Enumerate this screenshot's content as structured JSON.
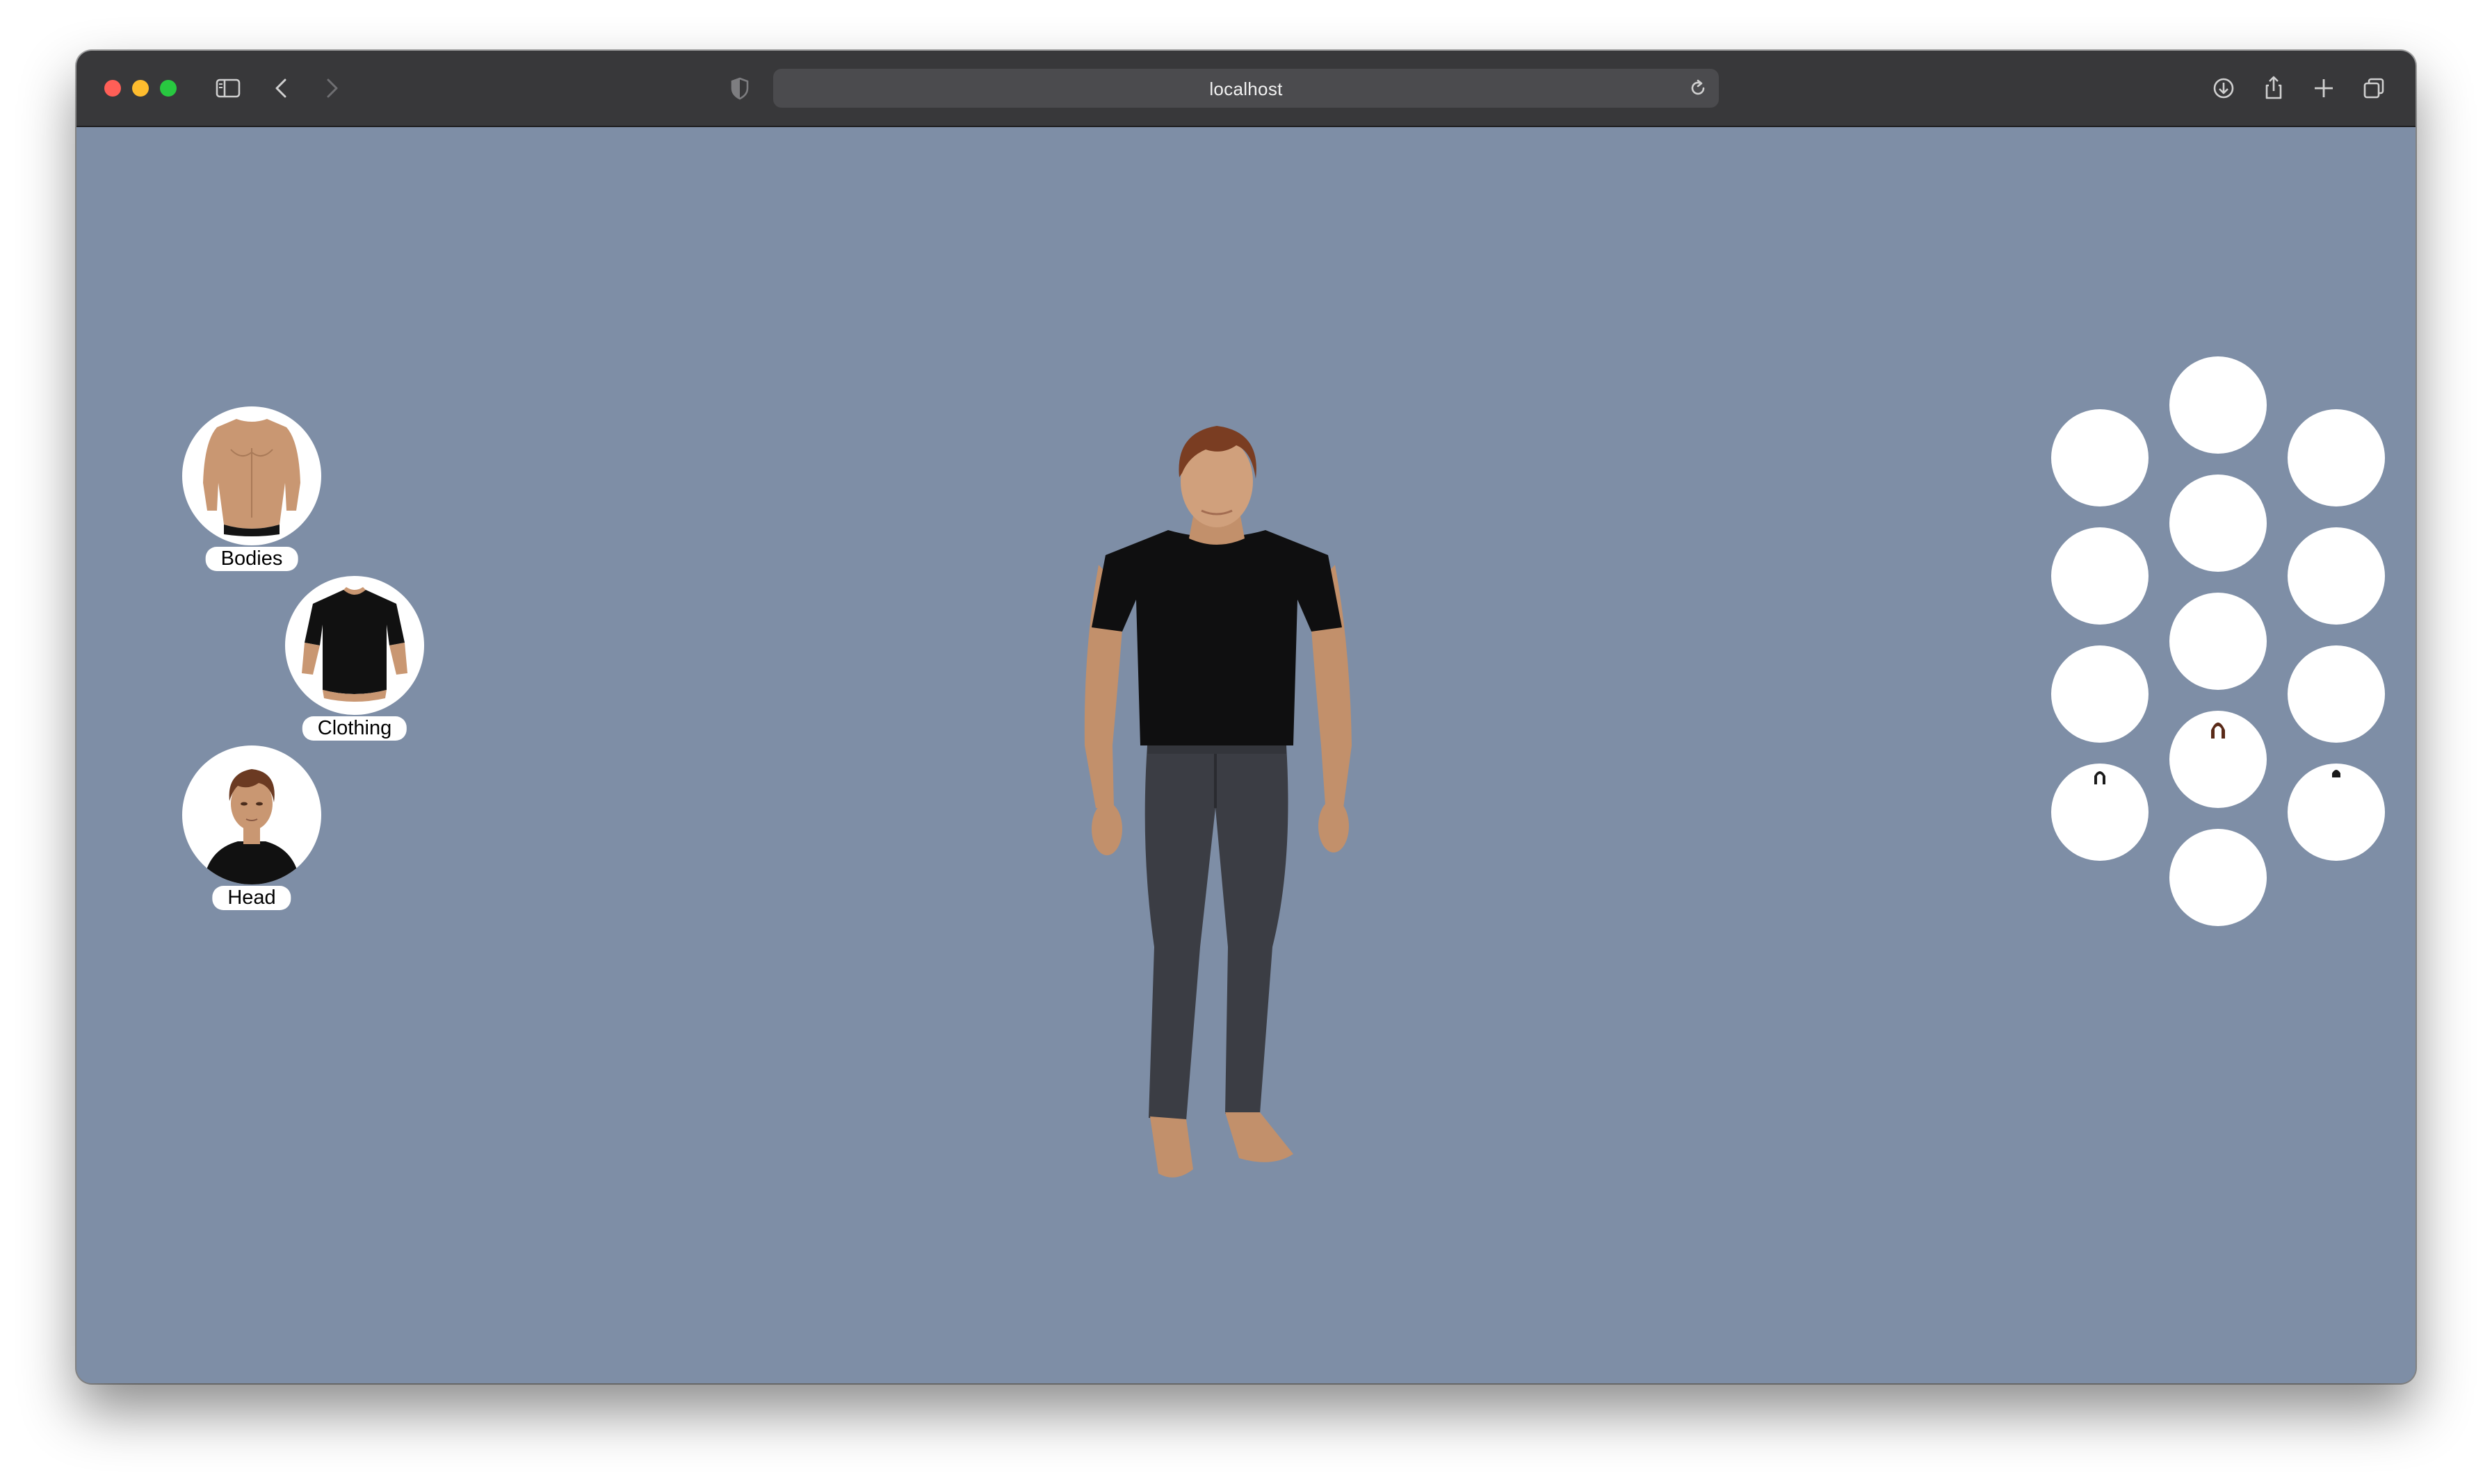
{
  "browser": {
    "url": "localhost",
    "traffic_lights": {
      "close": "#ff5f57",
      "minimize": "#febc2e",
      "zoom": "#28c840"
    },
    "toolbar_color": "#38383a"
  },
  "page": {
    "background": "#7e8ea6",
    "categories": [
      {
        "label": "Bodies",
        "icon": "torso-thumbnail"
      },
      {
        "label": "Clothing",
        "icon": "shirt-thumbnail"
      },
      {
        "label": "Head",
        "icon": "head-thumbnail"
      }
    ],
    "character": {
      "description_icon": "character-preview-figure"
    },
    "options": [
      {
        "id": "option-1",
        "thumbnail": "empty"
      },
      {
        "id": "option-2",
        "thumbnail": "empty"
      },
      {
        "id": "option-3",
        "thumbnail": "empty"
      },
      {
        "id": "option-4",
        "thumbnail": "empty"
      },
      {
        "id": "option-5",
        "thumbnail": "empty"
      },
      {
        "id": "option-6",
        "thumbnail": "empty"
      },
      {
        "id": "option-7",
        "thumbnail": "empty"
      },
      {
        "id": "option-8",
        "thumbnail": "empty"
      },
      {
        "id": "option-9",
        "thumbnail": "empty"
      },
      {
        "id": "option-10",
        "thumbnail": "hair"
      },
      {
        "id": "option-11",
        "thumbnail": "hair"
      },
      {
        "id": "option-12",
        "thumbnail": "hair"
      },
      {
        "id": "option-13",
        "thumbnail": "empty"
      }
    ]
  }
}
